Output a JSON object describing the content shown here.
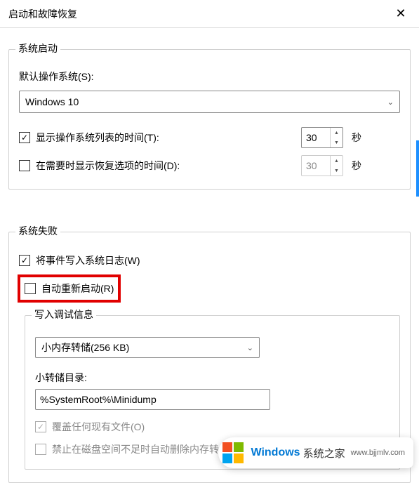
{
  "titlebar": {
    "title": "启动和故障恢复",
    "close_glyph": "✕"
  },
  "system_startup": {
    "group_title": "系统启动",
    "default_os_label": "默认操作系统(S):",
    "default_os_value": "Windows 10",
    "show_os_list_label": "显示操作系统列表的时间(T):",
    "show_os_list_checked": true,
    "show_os_list_seconds": "30",
    "show_recovery_label": "在需要时显示恢复选项的时间(D):",
    "show_recovery_checked": false,
    "show_recovery_seconds": "30",
    "unit_seconds": "秒"
  },
  "system_failure": {
    "group_title": "系统失败",
    "write_event_label": "将事件写入系统日志(W)",
    "write_event_checked": true,
    "auto_restart_label": "自动重新启动(R)",
    "auto_restart_checked": false,
    "debug_info": {
      "group_title": "写入调试信息",
      "dump_type_value": "小内存转储(256 KB)",
      "dump_dir_label": "小转储目录:",
      "dump_dir_value": "%SystemRoot%\\Minidump",
      "overwrite_label": "覆盖任何现有文件(O)",
      "overwrite_checked": true,
      "disable_low_disk_label": "禁止在磁盘空间不足时自动删除内存转储(A)",
      "disable_low_disk_checked": false
    }
  },
  "watermark": {
    "brand1": "Windows",
    "brand2": "系统之家",
    "url": "www.bjjmlv.com"
  },
  "glyphs": {
    "check": "✓",
    "chevron_down": "⌄",
    "arrow_up": "▲",
    "arrow_down": "▼"
  }
}
